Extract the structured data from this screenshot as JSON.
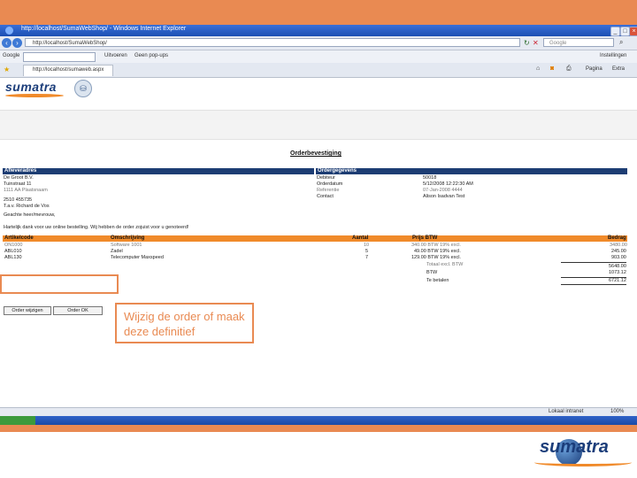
{
  "browser": {
    "title": "http://localhost/SumaWebShop/ - Windows Internet Explorer",
    "address": "http://localhost/SumaWebShop/",
    "search_placeholder": "Google",
    "toolbar": {
      "search_label": "Google",
      "btn1": "Uitvoeren",
      "btn2": "Geen pop-ups",
      "right": "Instellingen"
    },
    "tab_label": "http://localhost/sumaweb.aspx",
    "tab_right": {
      "page": "Pagina",
      "tools": "Extra"
    },
    "status": {
      "zone": "Lokaal intranet",
      "zoom": "100%"
    }
  },
  "page": {
    "logo_text": "sumatra",
    "title": "Orderbevestiging",
    "delivery": {
      "header": "Afleveradres",
      "lines": [
        "De Groot B.V.",
        "Tuinstraat 11",
        "1111 AA Plaatsnaam",
        "2510 455735",
        "T.a.v. Richard de Vos"
      ]
    },
    "order_info": {
      "header": "Ordergegevens",
      "labels": [
        "Debiteur",
        "Orderdatum",
        "Referentie",
        "Contact"
      ],
      "values": [
        "50018",
        "5/12/2008 12:22:30 AM",
        "07-Jan-2008 4444",
        "Alison Isadvan Test"
      ]
    },
    "greeting": "Geachte heer/mevrouw,",
    "thanks": "Hartelijk dank voor uw online bestelling. Wij hebben de order zojuist voor u genoteerd!",
    "columns": [
      "Artikelcode",
      "Omschrijving",
      "Aantal",
      "Prijs BTW",
      "Bedrag"
    ],
    "rows": [
      [
        "ON1000",
        "Software 1001",
        "10",
        "340.00 BTW 19% excl.",
        "3480.00"
      ],
      [
        "ABL010",
        "Zadel",
        "5",
        "49.00 BTW 19% excl.",
        "245.00"
      ],
      [
        "ABL130",
        "Telecomputer Maxspeed",
        "7",
        "129.00 BTW 19% excl.",
        "903.00"
      ]
    ],
    "subtotal_label": "Totaal excl. BTW",
    "subtotal_value": "5648.00",
    "btw_label": "BTW",
    "btw_value": "1073.12",
    "total_label": "Te betalen",
    "total_value": "6721.12",
    "buttons": {
      "edit": "Order wijzigen",
      "ok": "Order OK"
    }
  },
  "slide": {
    "callout": "Wijzig de order of maak deze definitief",
    "footer_logo": "sumatra"
  }
}
